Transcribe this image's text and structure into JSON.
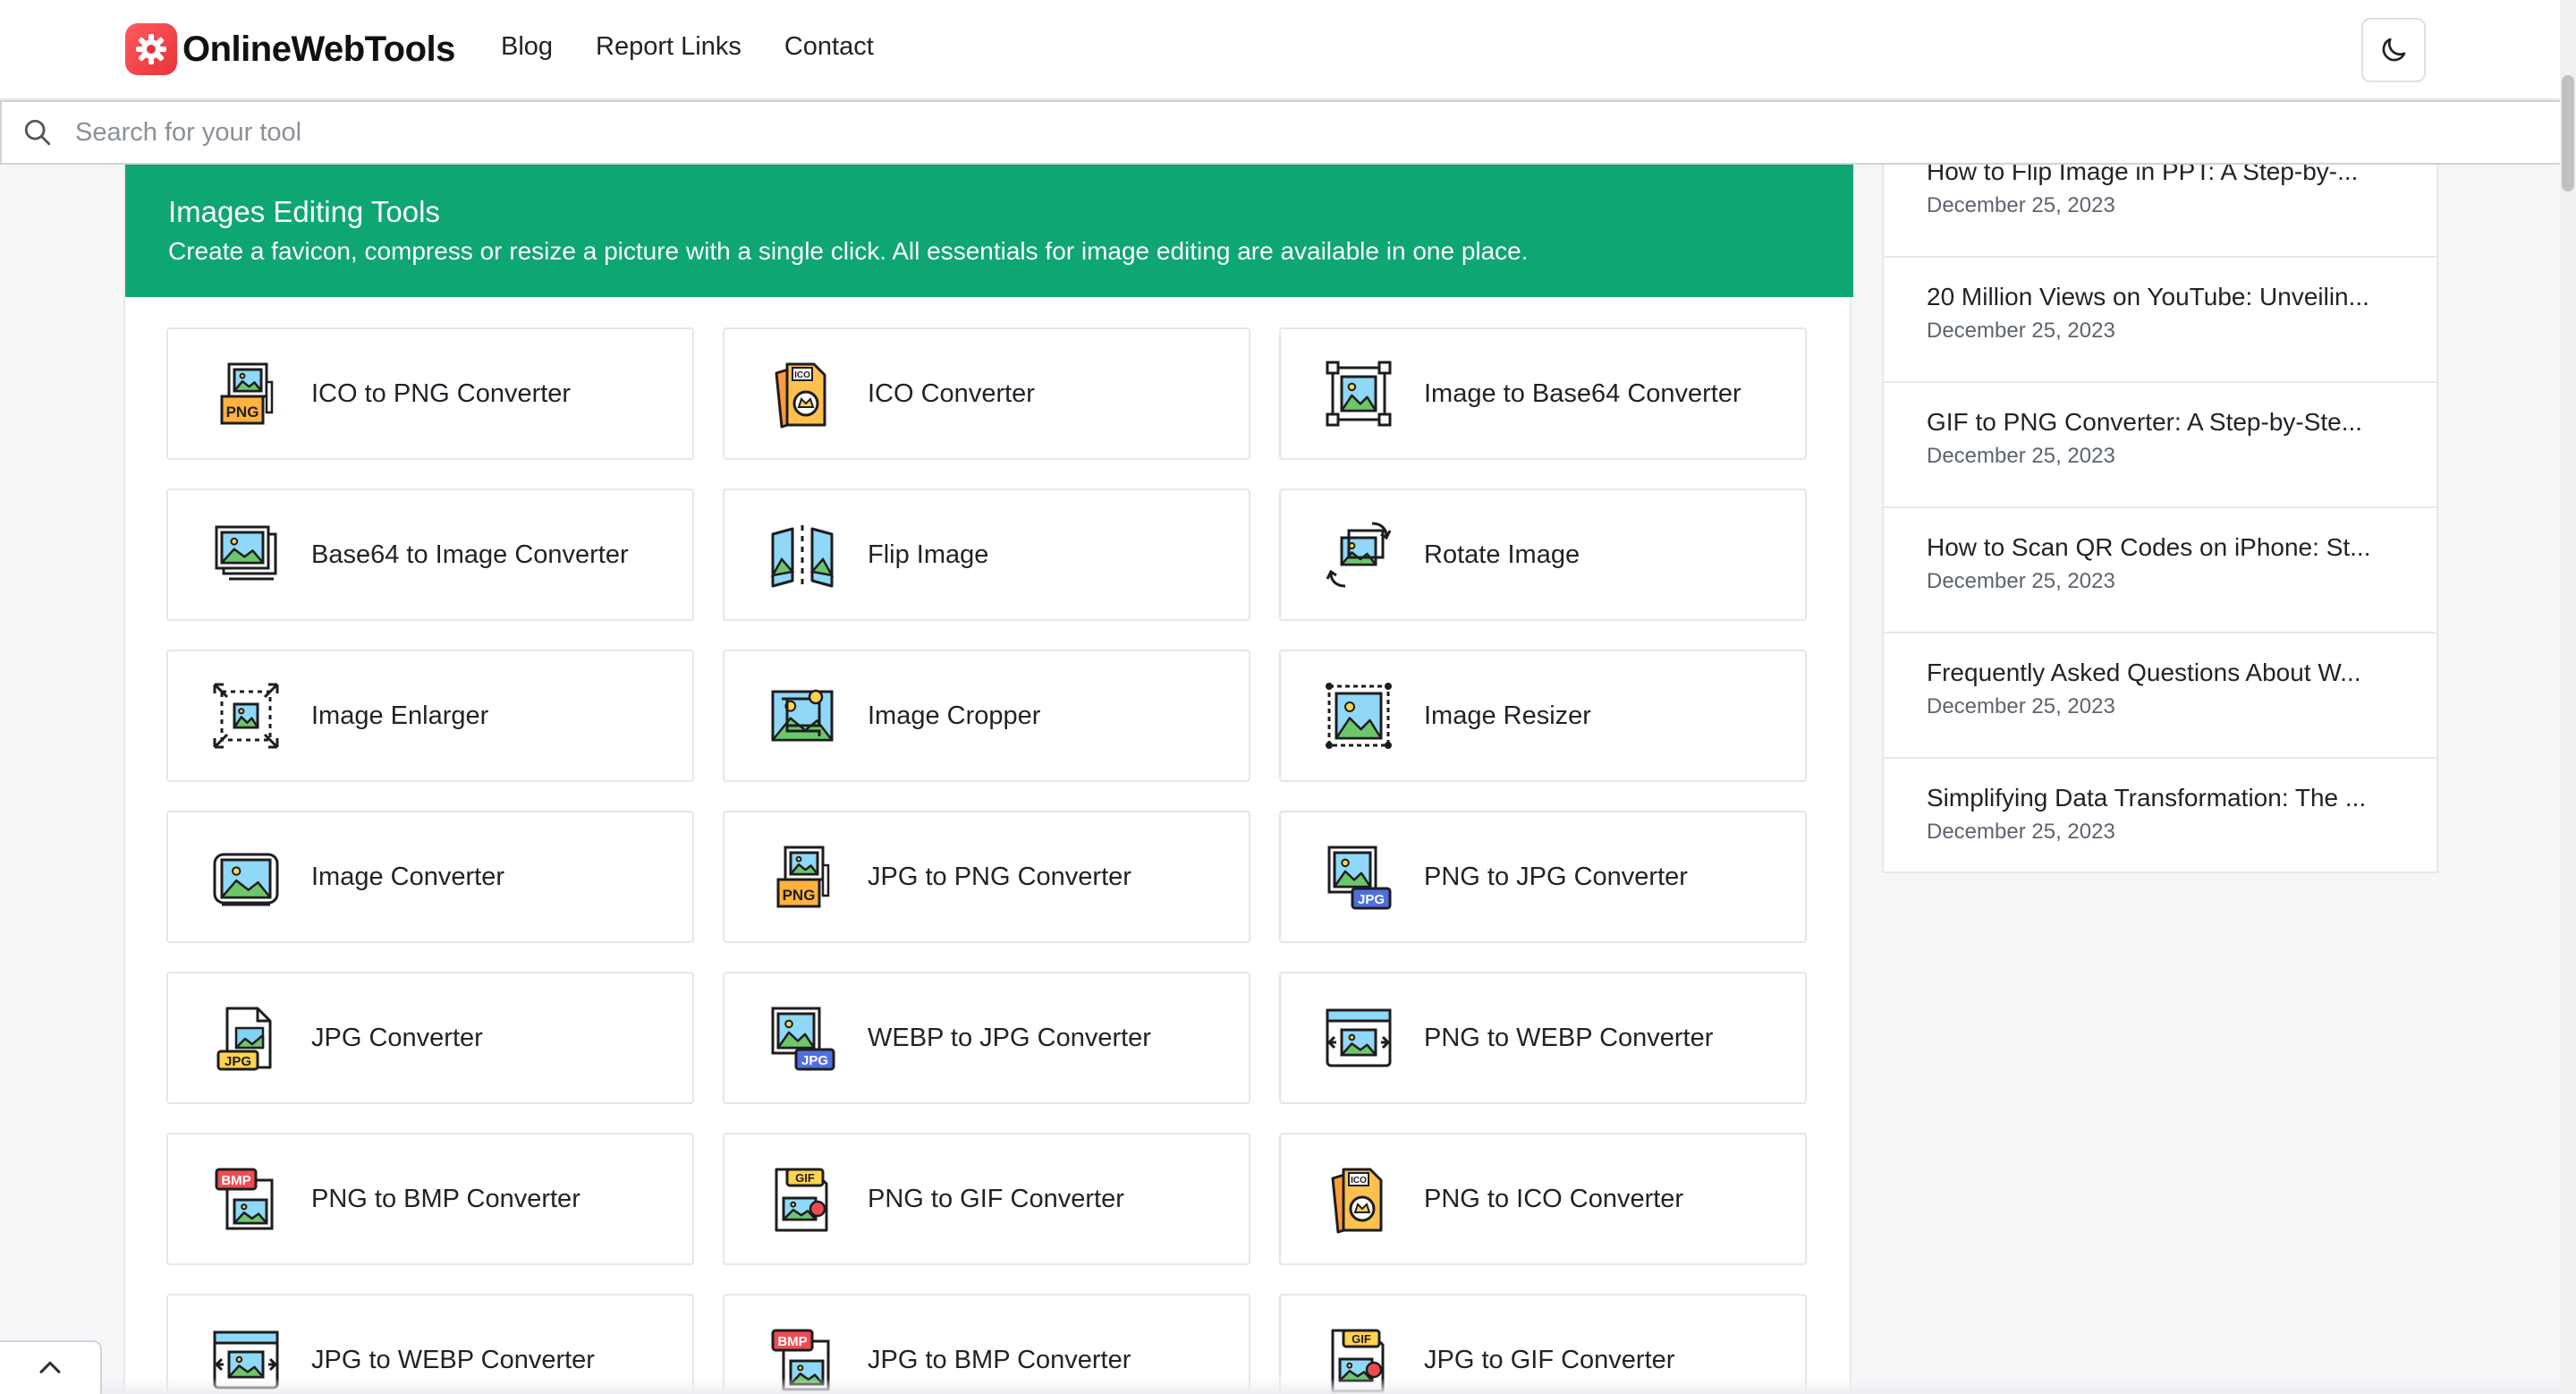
{
  "header": {
    "brand": "OnlineWebTools",
    "nav": [
      "Blog",
      "Report Links",
      "Contact"
    ],
    "theme_toggle_icon": "moon-icon"
  },
  "search": {
    "placeholder": "Search for your tool"
  },
  "banner": {
    "title": "Images Editing Tools",
    "description": "Create a favicon, compress or resize a picture with a single click. All essentials for image editing are available in one place."
  },
  "tools": [
    {
      "label": "ICO to PNG Converter",
      "icon": "png-file-icon"
    },
    {
      "label": "ICO Converter",
      "icon": "ico-file-icon"
    },
    {
      "label": "Image to Base64 Converter",
      "icon": "image-selection-icon"
    },
    {
      "label": "Base64 to Image Converter",
      "icon": "image-stack-icon"
    },
    {
      "label": "Flip Image",
      "icon": "flip-icon"
    },
    {
      "label": "Rotate Image",
      "icon": "rotate-icon"
    },
    {
      "label": "Image Enlarger",
      "icon": "enlarge-icon"
    },
    {
      "label": "Image Cropper",
      "icon": "crop-icon"
    },
    {
      "label": "Image Resizer",
      "icon": "resize-icon"
    },
    {
      "label": "Image Converter",
      "icon": "image-convert-icon"
    },
    {
      "label": "JPG to PNG Converter",
      "icon": "png-file-icon"
    },
    {
      "label": "PNG to JPG Converter",
      "icon": "jpg-badge-icon"
    },
    {
      "label": "JPG Converter",
      "icon": "jpg-file-icon"
    },
    {
      "label": "WEBP to JPG Converter",
      "icon": "jpg-badge-icon"
    },
    {
      "label": "PNG to WEBP Converter",
      "icon": "webp-window-icon"
    },
    {
      "label": "PNG to BMP Converter",
      "icon": "bmp-file-icon"
    },
    {
      "label": "PNG to GIF Converter",
      "icon": "gif-file-icon"
    },
    {
      "label": "PNG to ICO Converter",
      "icon": "ico-file-icon"
    },
    {
      "label": "JPG to WEBP Converter",
      "icon": "webp-window-icon"
    },
    {
      "label": "JPG to BMP Converter",
      "icon": "bmp-file-icon"
    },
    {
      "label": "JPG to GIF Converter",
      "icon": "gif-file-icon"
    }
  ],
  "blog_posts": [
    {
      "title": "How to Flip Image in PPT: A Step-by-...",
      "date": "December 25, 2023"
    },
    {
      "title": "20 Million Views on YouTube: Unveilin...",
      "date": "December 25, 2023"
    },
    {
      "title": "GIF to PNG Converter: A Step-by-Ste...",
      "date": "December 25, 2023"
    },
    {
      "title": "How to Scan QR Codes on iPhone: St...",
      "date": "December 25, 2023"
    },
    {
      "title": "Frequently Asked Questions About W...",
      "date": "December 25, 2023"
    },
    {
      "title": "Simplifying Data Transformation: The ...",
      "date": "December 25, 2023"
    }
  ],
  "colors": {
    "accent_green": "#0ea673",
    "brand_red": "#e8333a"
  }
}
